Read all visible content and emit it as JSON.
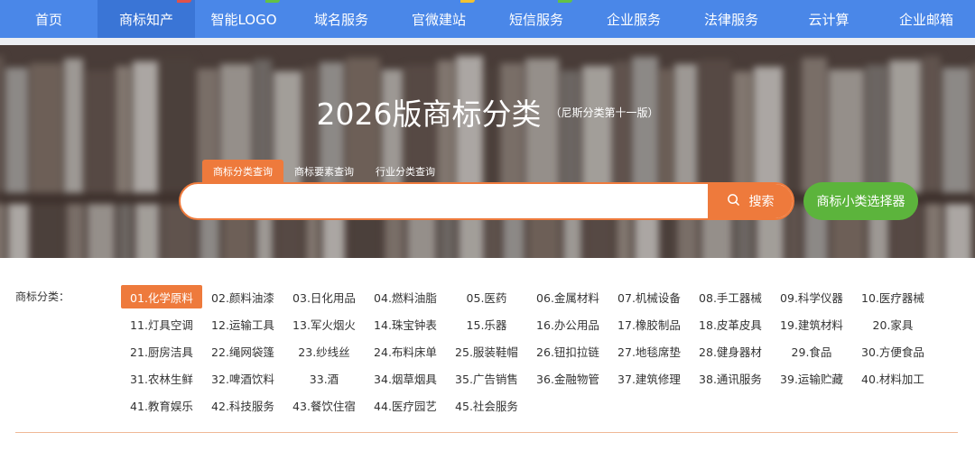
{
  "colors": {
    "nav": "#4a87e8",
    "accent": "#ee7a3c",
    "green": "#5cb43c"
  },
  "nav": {
    "items": [
      {
        "label": "首页",
        "active": false,
        "tag": ""
      },
      {
        "label": "商标知产",
        "active": true,
        "tag": "#e0524a"
      },
      {
        "label": "智能LOGO",
        "active": false,
        "tag": "#63c146"
      },
      {
        "label": "域名服务",
        "active": false,
        "tag": ""
      },
      {
        "label": "官微建站",
        "active": false,
        "tag": "#f2c230"
      },
      {
        "label": "短信服务",
        "active": false,
        "tag": "#63c146"
      },
      {
        "label": "企业服务",
        "active": false,
        "tag": ""
      },
      {
        "label": "法律服务",
        "active": false,
        "tag": ""
      },
      {
        "label": "云计算",
        "active": false,
        "tag": ""
      },
      {
        "label": "企业邮箱",
        "active": false,
        "tag": ""
      }
    ]
  },
  "hero": {
    "title": "2026版商标分类",
    "subtitle": "（尼斯分类第十一版）"
  },
  "search": {
    "tabs": [
      "商标分类查询",
      "商标要素查询",
      "行业分类查询"
    ],
    "active_tab": 0,
    "value": "",
    "placeholder": "",
    "button_label": "搜索",
    "search_icon": "search-icon",
    "picker_label": "商标小类选择器"
  },
  "categories": {
    "label": "商标分类：",
    "active_index": 0,
    "items": [
      "01.化学原料",
      "02.颜料油漆",
      "03.日化用品",
      "04.燃料油脂",
      "05.医药",
      "06.金属材料",
      "07.机械设备",
      "08.手工器械",
      "09.科学仪器",
      "10.医疗器械",
      "11.灯具空调",
      "12.运输工具",
      "13.军火烟火",
      "14.珠宝钟表",
      "15.乐器",
      "16.办公用品",
      "17.橡胶制品",
      "18.皮革皮具",
      "19.建筑材料",
      "20.家具",
      "21.厨房洁具",
      "22.绳网袋篷",
      "23.纱线丝",
      "24.布料床单",
      "25.服装鞋帽",
      "26.钮扣拉链",
      "27.地毯席垫",
      "28.健身器材",
      "29.食品",
      "30.方便食品",
      "31.农林生鲜",
      "32.啤酒饮料",
      "33.酒",
      "34.烟草烟具",
      "35.广告销售",
      "36.金融物管",
      "37.建筑修理",
      "38.通讯服务",
      "39.运输贮藏",
      "40.材料加工",
      "41.教育娱乐",
      "42.科技服务",
      "43.餐饮住宿",
      "44.医疗园艺",
      "45.社会服务"
    ]
  }
}
